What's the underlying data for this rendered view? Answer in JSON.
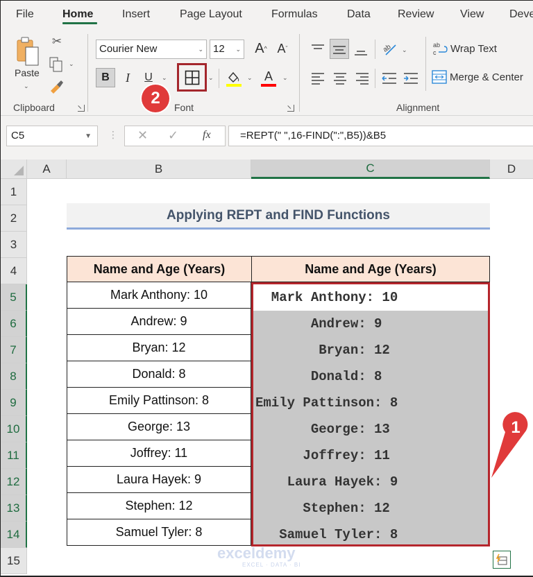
{
  "ribbon": {
    "tabs": [
      {
        "label": "File"
      },
      {
        "label": "Home",
        "active": true
      },
      {
        "label": "Insert"
      },
      {
        "label": "Page Layout"
      },
      {
        "label": "Formulas"
      },
      {
        "label": "Data"
      },
      {
        "label": "Review"
      },
      {
        "label": "View"
      },
      {
        "label": "Deve"
      }
    ],
    "clipboard": {
      "paste_label": "Paste",
      "group_label": "Clipboard",
      "icons": [
        "paste-icon",
        "cut-icon",
        "copy-icon",
        "format-painter-icon"
      ]
    },
    "font": {
      "font_name": "Courier New",
      "font_size": "12",
      "bold_label": "B",
      "italic_label": "I",
      "underline_label": "U",
      "increase_size_label": "A",
      "decrease_size_label": "A",
      "font_color_label": "A",
      "group_label": "Font",
      "highlight_color": "#ffff00",
      "font_color": "#ff0000",
      "icons": [
        "borders-icon",
        "fill-color-icon"
      ]
    },
    "alignment": {
      "wrap_text_label": "Wrap Text",
      "merge_center_label": "Merge & Center",
      "group_label": "Alignment",
      "icons": [
        "top-align-icon",
        "middle-align-icon",
        "bottom-align-icon",
        "orientation-icon",
        "align-left-icon",
        "center-icon",
        "align-right-icon",
        "decrease-indent-icon",
        "increase-indent-icon"
      ]
    }
  },
  "formula_bar": {
    "name_box": "C5",
    "cancel_icon": "✕",
    "enter_icon": "✓",
    "fx_label": "fx",
    "formula": "=REPT(\" \",16-FIND(\":\",B5))&B5"
  },
  "grid": {
    "columns": [
      "A",
      "B",
      "C",
      "D"
    ],
    "selected_column": "C",
    "rows": [
      "1",
      "2",
      "3",
      "4",
      "5",
      "6",
      "7",
      "8",
      "9",
      "10",
      "11",
      "12",
      "13",
      "14",
      "15"
    ],
    "selected_rows": [
      "5",
      "6",
      "7",
      "8",
      "9",
      "10",
      "11",
      "12",
      "13",
      "14"
    ],
    "title": "Applying REPT and FIND Functions",
    "header_b": "Name and Age (Years)",
    "header_c": "Name and Age (Years)",
    "column_b": [
      "Mark Anthony: 10",
      "Andrew: 9",
      "Bryan: 12",
      "Donald: 8",
      "Emily Pattinson: 8",
      "George: 13",
      "Joffrey: 11",
      "Laura Hayek: 9",
      "Stephen: 12",
      "Samuel Tyler: 8"
    ],
    "column_c": [
      "  Mark Anthony: 10",
      "       Andrew: 9",
      "        Bryan: 12",
      "       Donald: 8",
      "Emily Pattinson: 8",
      "       George: 13",
      "      Joffrey: 11",
      "    Laura Hayek: 9",
      "      Stephen: 12",
      "   Samuel Tyler: 8"
    ]
  },
  "annotations": {
    "step1": "1",
    "step2": "2",
    "accent_color": "#e03a3a",
    "highlight_border_color": "#b5262c"
  },
  "watermark": {
    "brand": "exceldemy",
    "tagline": "EXCEL · DATA · BI"
  }
}
